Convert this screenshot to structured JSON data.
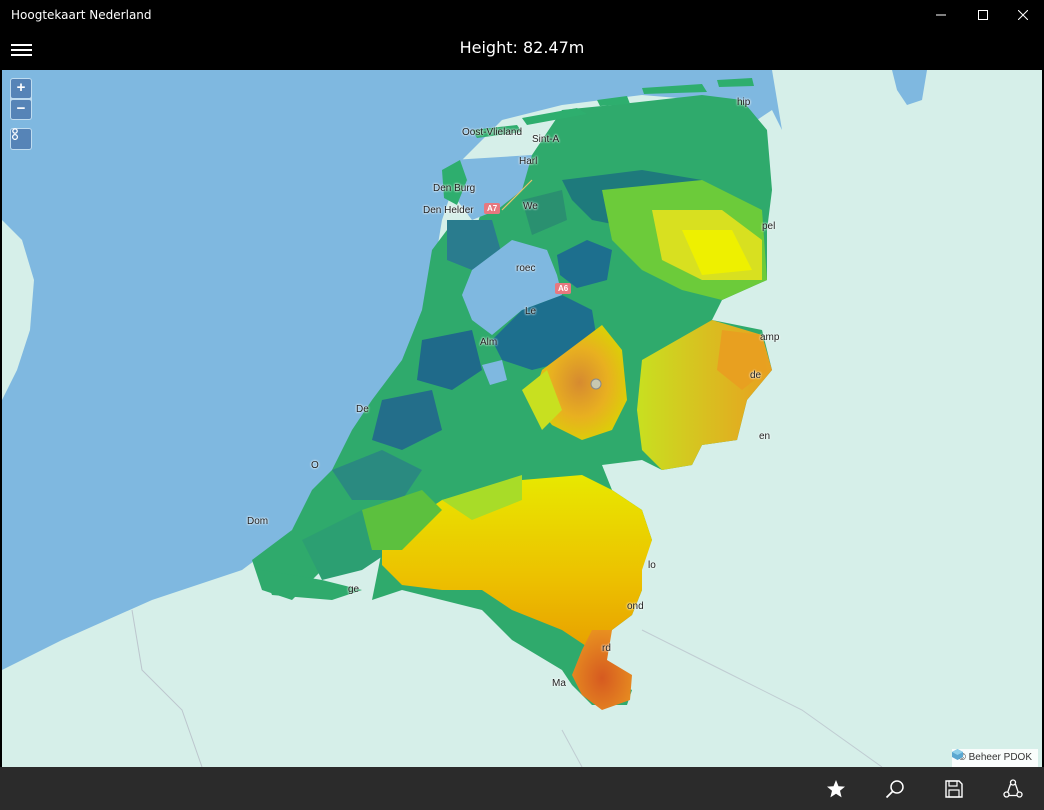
{
  "window": {
    "title": "Hoogtekaart Nederland"
  },
  "header": {
    "height_text": "Height: 82.47m"
  },
  "map": {
    "zoom_in_label": "+",
    "zoom_out_label": "−",
    "attribution": "© Beheer PDOK",
    "labels": {
      "oost_vlieland": "Oost-Vlieland",
      "sint_a": "Sint-A",
      "harl": "Harl",
      "den_burg": "Den Burg",
      "den_helder": "Den Helder",
      "we": "We",
      "schip": "hip",
      "pel": "pel",
      "roec": "roec",
      "le": "Le",
      "alm": "Alm",
      "hamp": "amp",
      "de": "de",
      "en": "en",
      "den": "De",
      "o": "O",
      "dom": "Dom",
      "lo": "lo",
      "ond": "ond",
      "rd": "rd",
      "ge": "ge",
      "ma": "Ma"
    },
    "road_shields": {
      "a7": "A7",
      "a6": "A6"
    }
  },
  "colors": {
    "sea": "#7fb8e0",
    "land_bg": "#d6efe9",
    "low": "#1b6a8f",
    "mid": "#2aae6b",
    "high": "#e8e000",
    "peak": "#e07a22"
  }
}
